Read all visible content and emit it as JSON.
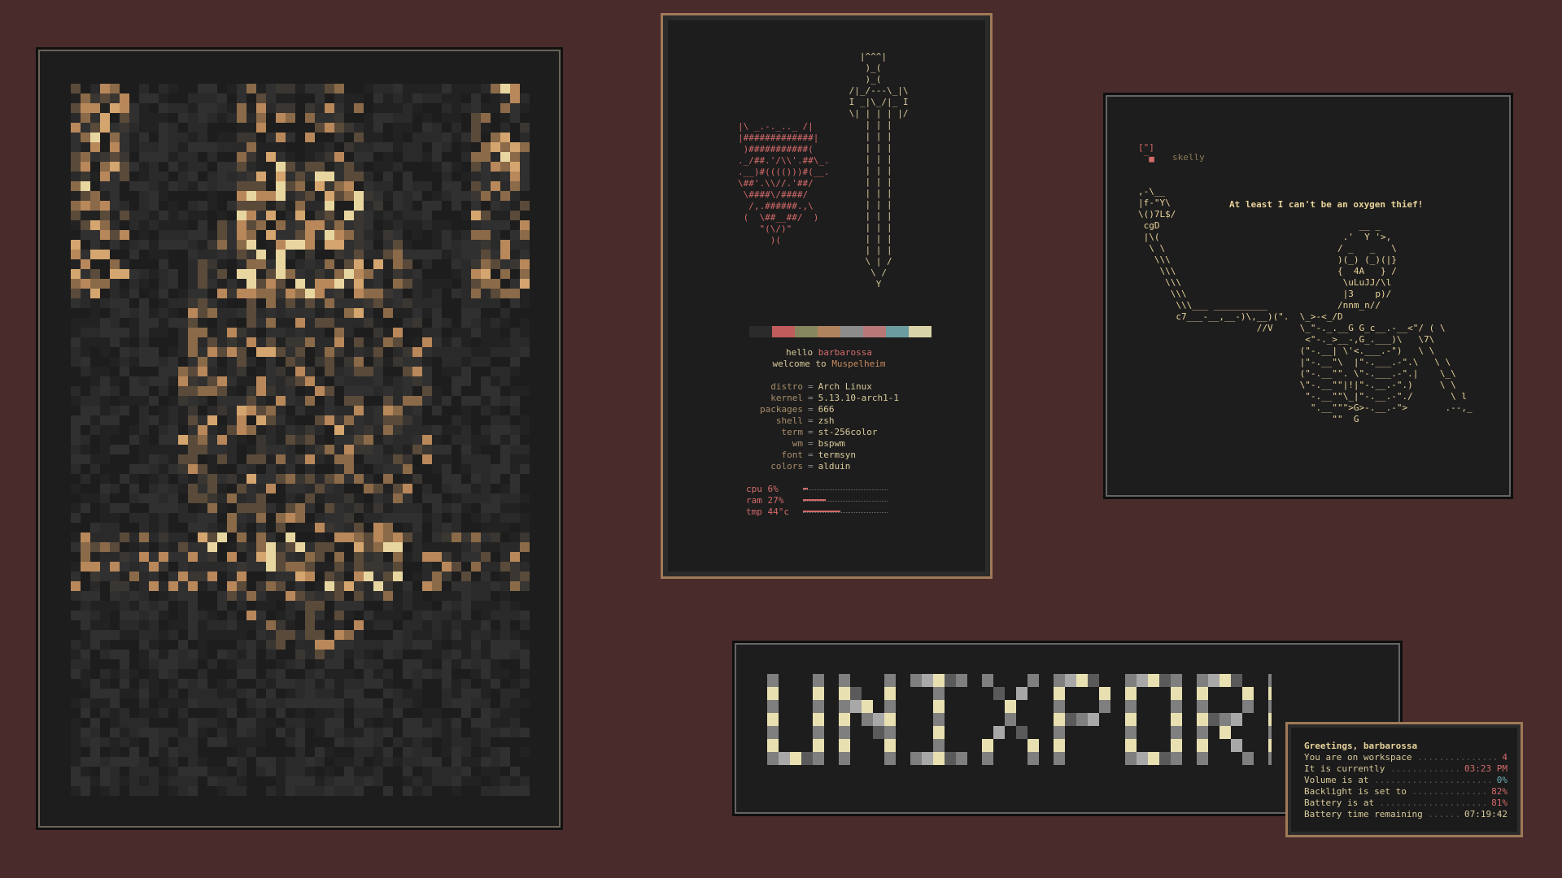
{
  "fetch": {
    "skull_ascii": "|\\ _.-._.._ /|\n|#############|\n )###########(\n._/##.'/\\\\'.##\\_.\n.__)#(((()))#(__.\n\\##'.\\\\//.'##/\n \\####\\/####/\n  /,.######.,\\\n (  \\##__##/  )\n    \"(\\/)\"\n      )(",
    "sword_ascii": "   |^^^|\n    )_(\n    )_(\n /|_/---\\_|\\\n I _|\\_/|_ I\n \\| | | | |/\n    | | |\n    | | |\n    | | |\n    | | |\n    | | |\n    | | |\n    | | |\n    | | |\n    | | |\n    | | |\n    | | |\n    | | |\n    \\ | /\n     \\ /\n      Y",
    "greeting_prefix": "hello ",
    "user": "barbarossa",
    "welcome_prefix": "welcome to ",
    "host": "Muspelheim",
    "info": [
      {
        "key": "distro",
        "value": "Arch Linux"
      },
      {
        "key": "kernel",
        "value": "5.13.10-arch1-1"
      },
      {
        "key": "packages",
        "value": "666"
      },
      {
        "key": "shell",
        "value": "zsh"
      },
      {
        "key": "term",
        "value": "st-256color"
      },
      {
        "key": "wm",
        "value": "bspwm"
      },
      {
        "key": "font",
        "value": "termsyn"
      },
      {
        "key": "colors",
        "value": "alduin"
      }
    ],
    "meters": [
      {
        "label": "cpu 6%",
        "level": 0.06
      },
      {
        "label": "ram 27%",
        "level": 0.27
      },
      {
        "label": "tmp 44°c",
        "level": 0.44
      }
    ],
    "swatches": [
      "#1d1d1d",
      "#2b2b2b",
      "#c05c5c",
      "#87875f",
      "#b0835f",
      "#8c8c8c",
      "#b87878",
      "#6b9da0",
      "#d8d3a8"
    ]
  },
  "skelly": {
    "icon": "[\"]\n ‾■",
    "name": "skelly",
    "quote": "At least I can't be an oxygen thief!",
    "ascii": ",-\\__\n|f-\"Y\\\n\\()7L$/\n cgD                                     __ _\n |\\(                                  .'  Y '>,\n  \\ \\                                / _   _   \\\n   \\\\\\                               )(_) (_)(|}\n    \\\\\\                              {  4A   } /\n     \\\\\\                              \\uLuJJ/\\l\n      \\\\\\                             |3    p)/\n       \\\\\\___ __________             /nnm_n//\n       c7___-__,__-)\\,__)(\".  \\_>-<_/D\n                      //V     \\_\"-._.__G G_c__.-__<\"/ ( \\\n                               <\"-._>__-,G_.___)\\   \\7\\\n                              (\"-.__| \\'<.___.-\")   \\ \\\n                              |\"-.__\"\\  |\"-.___.-\".\\   \\ \\\n                              (\"-.__\"\". \\\"-.___.-\".|    \\_\\\n                              \\\"-.__\"\"|!|\"-.__.-\".)     \\ \\\n                               \"-.__\"\"\\_|\"-.__.-\"./       \\ l\n                                \".__\"\"\">G>-.__.-\">       .--,_\n                                    \"\"  G"
  },
  "banner": {
    "text": "UNIXPORN"
  },
  "status": {
    "title": "Greetings, barbarossa",
    "rows": [
      {
        "label": "You are on workspace",
        "value": "4",
        "accent": "red"
      },
      {
        "label": "It is currently",
        "value": "03:23 PM",
        "accent": "red"
      },
      {
        "label": "Volume is at",
        "value": "0%",
        "accent": "teal"
      },
      {
        "label": "Backlight is set to",
        "value": "82%",
        "accent": "red"
      },
      {
        "label": "Battery is at",
        "value": "81%",
        "accent": "red"
      },
      {
        "label": "Battery time remaining",
        "value": "07:19:42",
        "accent": "plain"
      }
    ]
  }
}
